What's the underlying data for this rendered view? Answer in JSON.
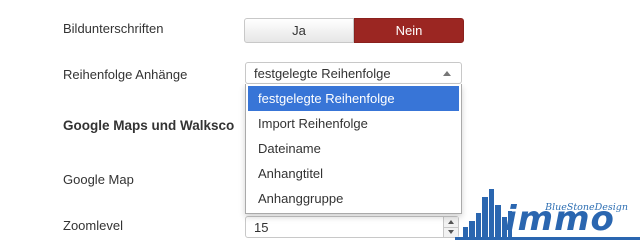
{
  "fields": {
    "captions": {
      "label": "Bildunterschriften",
      "yes": "Ja",
      "no": "Nein",
      "active": "Nein"
    },
    "order": {
      "label": "Reihenfolge Anhänge",
      "selected": "festgelegte Reihenfolge",
      "options": [
        "festgelegte Reihenfolge",
        "Import Reihenfolge",
        "Dateiname",
        "Anhangtitel",
        "Anhanggruppe"
      ]
    },
    "section_heading": "Google Maps und Walksco",
    "google_map": {
      "label": "Google Map"
    },
    "zoom": {
      "label": "Zoomlevel",
      "value": "15"
    }
  },
  "logo": {
    "tagline": "BlueStoneDesign",
    "wordmark": "immo"
  },
  "colors": {
    "toggle_active": "#9b2622",
    "option_highlight": "#3875d7",
    "logo_blue": "#2a66b0"
  },
  "icons": [
    "dropdown-arrow-icon",
    "spin-up-icon",
    "spin-down-icon"
  ]
}
